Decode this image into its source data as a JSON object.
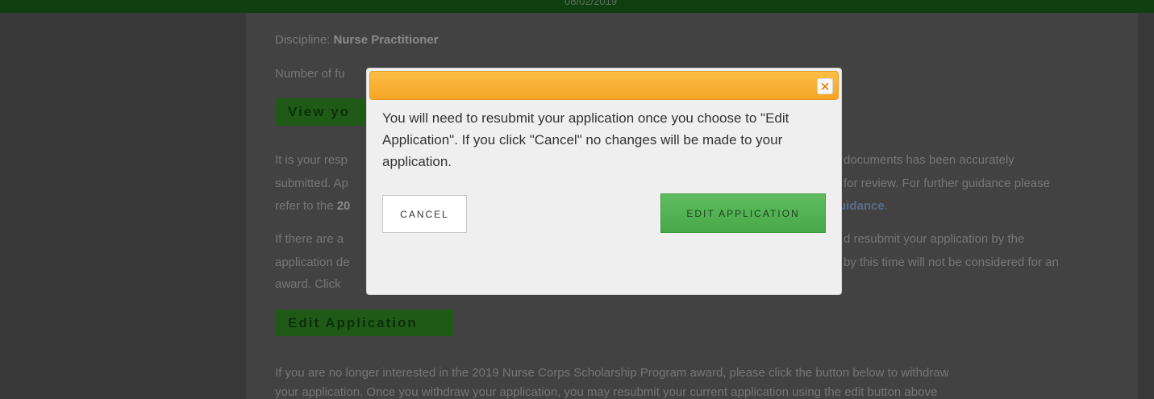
{
  "header": {
    "top_text": "08/02/2019"
  },
  "background": {
    "discipline_label": "Discipline:",
    "discipline_value": "Nurse Practitioner",
    "funding_line": "Number of fu",
    "view_button": "View yo",
    "para1_line1_left": "It is your resp",
    "para1_line1_right": "documents has been accurately",
    "para1_line2_left": "submitted. Ap",
    "para1_line2_right": "for review. For further guidance please",
    "para1_line3_left": "refer to the",
    "para1_line3_bold": "20",
    "para1_line3_right": "uidance",
    "para2_line1_left": "If there are a",
    "para2_line1_right": "d resubmit your application by the",
    "para2_line2_left": "application de",
    "para2_line2_right": "by this time will not be considered for an",
    "para2_line3_left": "award. Click",
    "edit_application_button": "Edit Application",
    "para3_line1": "If you are no longer interested in the 2019 Nurse Corps Scholarship Program award, please click the button below to withdraw",
    "para3_line2": "your application. Once you withdraw your application, you may resubmit your current application using the edit button above"
  },
  "modal": {
    "close_glyph": "×",
    "message": "You will need to resubmit your application once you choose to \"Edit Application\". If you click \"Cancel\" no changes will be made to your application.",
    "cancel_label": "CANCEL",
    "confirm_label": "EDIT APPLICATION"
  },
  "colors": {
    "overlay": "#424242",
    "header_bar": "#0f3f10",
    "modal_header": "#f5a525",
    "confirm_button": "#4cae4c"
  }
}
